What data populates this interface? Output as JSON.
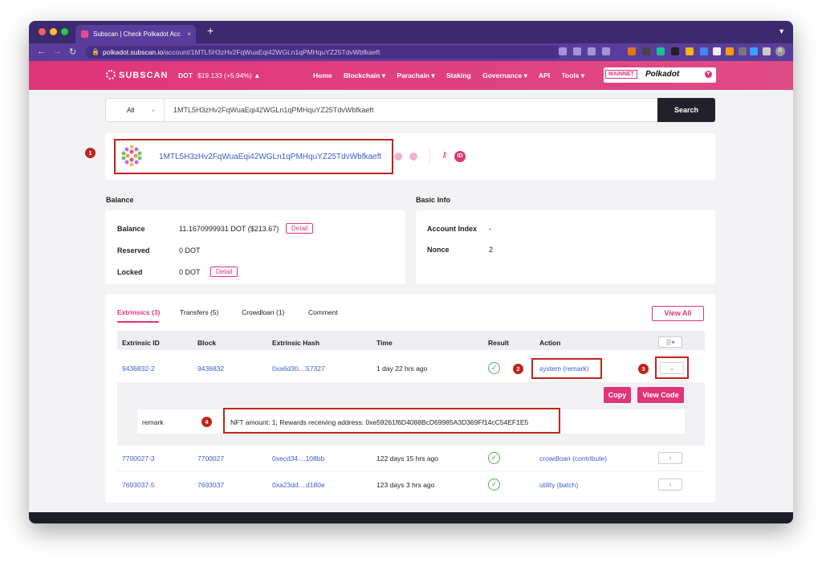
{
  "browser": {
    "tab_title": "Subscan | Check Polkadot Acc",
    "tab_close": "×",
    "new_tab": "+",
    "url_domain": "polkadot.subscan.io",
    "url_path": "/account/1MTL5H3zHv2FqWuaEqi42WGLn1qPMHquYZ25TdvWbfkaeft",
    "profile_initial": "R"
  },
  "header": {
    "logo": "SUBSCAN",
    "token": "DOT",
    "price": "$19.133 (+5.94%)",
    "menu": [
      "Home",
      "Blockchain ▾",
      "Parachain ▾",
      "Staking",
      "Governance ▾",
      "API",
      "Tools ▾"
    ],
    "network_badge": "MAINNET",
    "network_name": "Polkadot"
  },
  "search": {
    "filter": "All",
    "query": "1MTL5H3zHv2FqWuaEqi42WGLn1qPMHquYZ25TdvWbfkaeft",
    "button": "Search"
  },
  "account": {
    "address": "1MTL5H3zHv2FqWuaEqi42WGLn1qPMHquYZ25TdvWbfkaeft",
    "id_badge": "ID"
  },
  "balance": {
    "title": "Balance",
    "rows": [
      {
        "label": "Balance",
        "value": "11.1670999931 DOT ($213.67)",
        "button": "Detail"
      },
      {
        "label": "Reserved",
        "value": "0 DOT",
        "button": ""
      },
      {
        "label": "Locked",
        "value": "0 DOT",
        "button": "Detail"
      }
    ]
  },
  "basic_info": {
    "title": "Basic Info",
    "rows": [
      {
        "label": "Account Index",
        "value": "-"
      },
      {
        "label": "Nonce",
        "value": "2"
      }
    ]
  },
  "tabs": [
    "Extrinsics (3)",
    "Transfers (5)",
    "Crowdloan (1)",
    "Comment"
  ],
  "view_all": "View All",
  "table": {
    "columns": [
      "Extrinsic ID",
      "Block",
      "Extrinsic Hash",
      "Time",
      "Result",
      "Action"
    ],
    "rows": [
      {
        "id": "9436832-2",
        "block": "9436832",
        "hash": "0xa6d30....57327",
        "time": "1 day 22 hrs ago",
        "action": "system (remark)"
      },
      {
        "id": "7700027-3",
        "block": "7700027",
        "hash": "0xecd34....108bb",
        "time": "122 days 15 hrs ago",
        "action": "crowdloan (contribute)"
      },
      {
        "id": "7693037-5",
        "block": "7693037",
        "hash": "0xa23dd....d180e",
        "time": "123 days 3 hrs ago",
        "action": "utility (batch)"
      }
    ],
    "detail": {
      "copy": "Copy",
      "view_code": "View Code",
      "param_name": "remark",
      "param_value": "NFT amount: 1; Rewards receiving address: 0xe59261f6D4088BcD69985A3D369Ff14cC54EF1E5"
    }
  },
  "annotations": [
    "1",
    "2",
    "3",
    "4"
  ],
  "colors": {
    "brand": "#e0357a",
    "browser": "#3b2a6e",
    "annotation": "#c0241c",
    "link": "#3b5fc9"
  }
}
